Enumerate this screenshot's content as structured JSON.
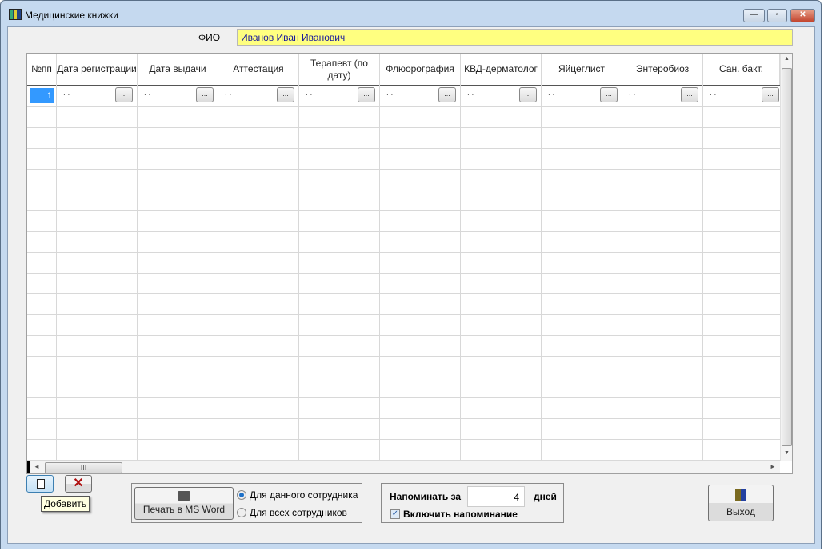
{
  "window": {
    "title": "Медицинские книжки",
    "minimize": "—",
    "maximize": "▫",
    "close": "✕"
  },
  "fio": {
    "label": "ФИО",
    "value": "Иванов Иван Иванович"
  },
  "grid": {
    "columns": [
      "№пп",
      "Дата регистрации",
      "Дата выдачи",
      "Аттестация",
      "Терапевт (по дату)",
      "Флюорография",
      "КВД-дерматолог",
      "Яйцеглист",
      "Энтеробиоз",
      "Сан. бакт."
    ],
    "first_row": {
      "number": "1",
      "date_placeholder": ". .",
      "ellipsis": "..."
    },
    "hscroll_thumb": "III"
  },
  "toolbar": {
    "add_icon": "new-document-icon",
    "delete_icon": "delete-x-icon",
    "tooltip": "Добавить"
  },
  "print": {
    "button_label": "Печать в MS Word",
    "option_current": "Для данного сотрудника",
    "option_all": "Для всех сотрудников",
    "selected": "current"
  },
  "reminder": {
    "label": "Напоминать за",
    "days_value": "4",
    "days_unit": "дней",
    "enable_label": "Включить напоминание",
    "enabled": true
  },
  "exit": {
    "label": "Выход"
  }
}
